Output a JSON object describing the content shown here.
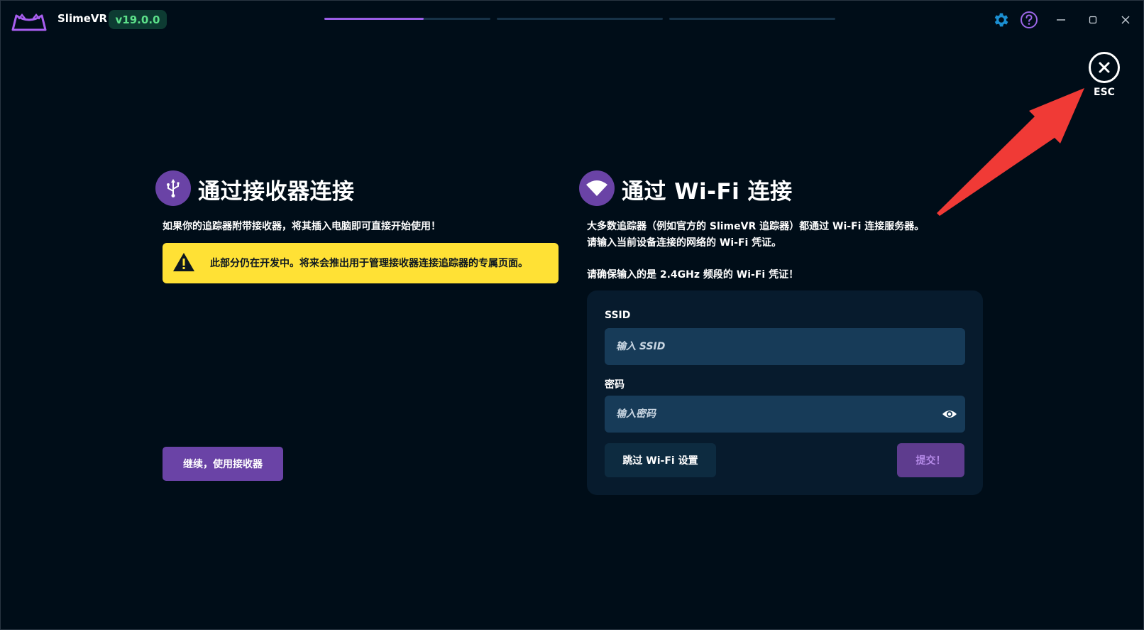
{
  "app": {
    "title": "SlimeVR",
    "version": "v19.0.0",
    "steps": [
      {
        "progress": 0.6
      },
      {
        "progress": 0
      },
      {
        "progress": 0
      }
    ],
    "icons": [
      "slimevr-logo-icon",
      "gear-icon",
      "help-icon",
      "minimize-icon",
      "maximize-icon",
      "close-icon"
    ]
  },
  "esc": {
    "label": "ESC",
    "icon": "close-circle-icon"
  },
  "receiver": {
    "icon": "usb-icon",
    "title": "通过接收器连接",
    "description": "如果你的追踪器附带接收器，将其插入电脑即可直接开始使用！",
    "warning": "此部分仍在开发中。将来会推出用于管理接收器连接追踪器的专属页面。",
    "continue_label": "继续，使用接收器"
  },
  "wifi": {
    "icon": "wifi-icon",
    "title": "通过 Wi-Fi 连接",
    "description_line1": "大多数追踪器（例如官方的 SlimeVR 追踪器）都通过 Wi-Fi 连接服务器。",
    "description_line2": "请输入当前设备连接的网络的 Wi-Fi 凭证。",
    "band_note": "请确保输入的是 2.4GHz 频段的 Wi-Fi 凭证！",
    "ssid_label": "SSID",
    "ssid_placeholder": "输入 SSID",
    "password_label": "密码",
    "password_placeholder": "输入密码",
    "skip_label": "跳过 Wi-Fi 设置",
    "submit_label": "提交！"
  },
  "colors": {
    "background": "#000d18",
    "accent": "#6a43a6",
    "version_text": "#5ce08a",
    "warning": "#ffe135",
    "input": "#173b58",
    "arrow": "#f03a36"
  }
}
